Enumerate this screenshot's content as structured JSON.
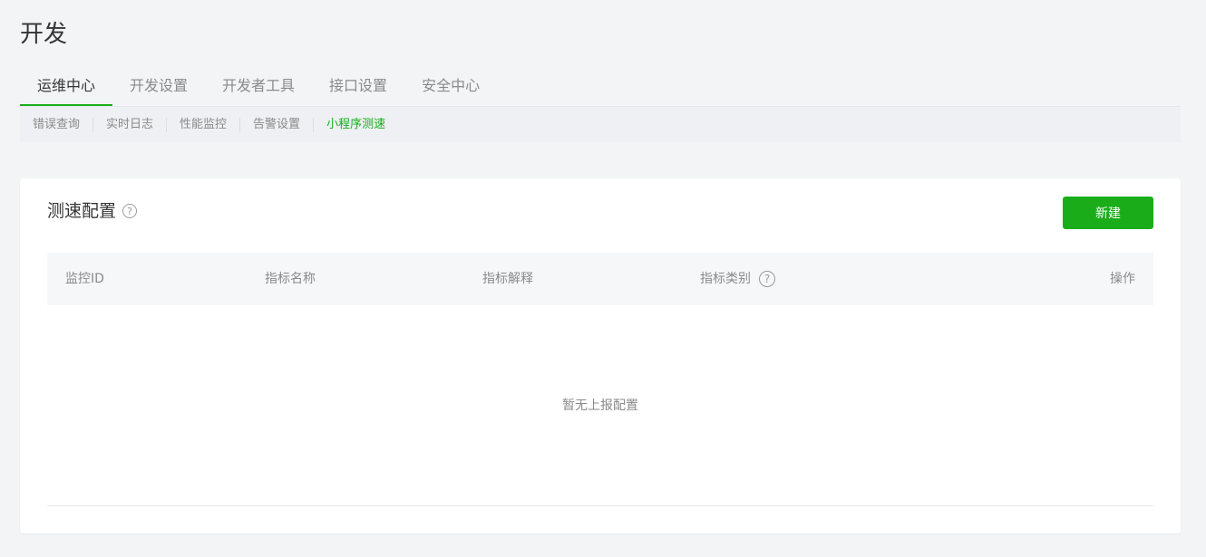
{
  "page": {
    "title": "开发"
  },
  "main_tabs": [
    {
      "label": "运维中心",
      "active": true
    },
    {
      "label": "开发设置",
      "active": false
    },
    {
      "label": "开发者工具",
      "active": false
    },
    {
      "label": "接口设置",
      "active": false
    },
    {
      "label": "安全中心",
      "active": false
    }
  ],
  "sub_tabs": [
    {
      "label": "错误查询",
      "active": false
    },
    {
      "label": "实时日志",
      "active": false
    },
    {
      "label": "性能监控",
      "active": false
    },
    {
      "label": "告警设置",
      "active": false
    },
    {
      "label": "小程序测速",
      "active": true
    }
  ],
  "speed_config": {
    "title": "测速配置",
    "help_icon": "question-circle-icon",
    "new_button_label": "新建",
    "columns": [
      {
        "label": "监控ID",
        "has_help": false
      },
      {
        "label": "指标名称",
        "has_help": false
      },
      {
        "label": "指标解释",
        "has_help": false
      },
      {
        "label": "指标类别",
        "has_help": true
      },
      {
        "label": "操作",
        "has_help": false
      }
    ],
    "rows": [],
    "empty_text": "暂无上报配置"
  },
  "colors": {
    "accent": "#1aad19",
    "background": "#f3f4f6",
    "card": "#ffffff",
    "muted_text": "#8a8a8a"
  }
}
